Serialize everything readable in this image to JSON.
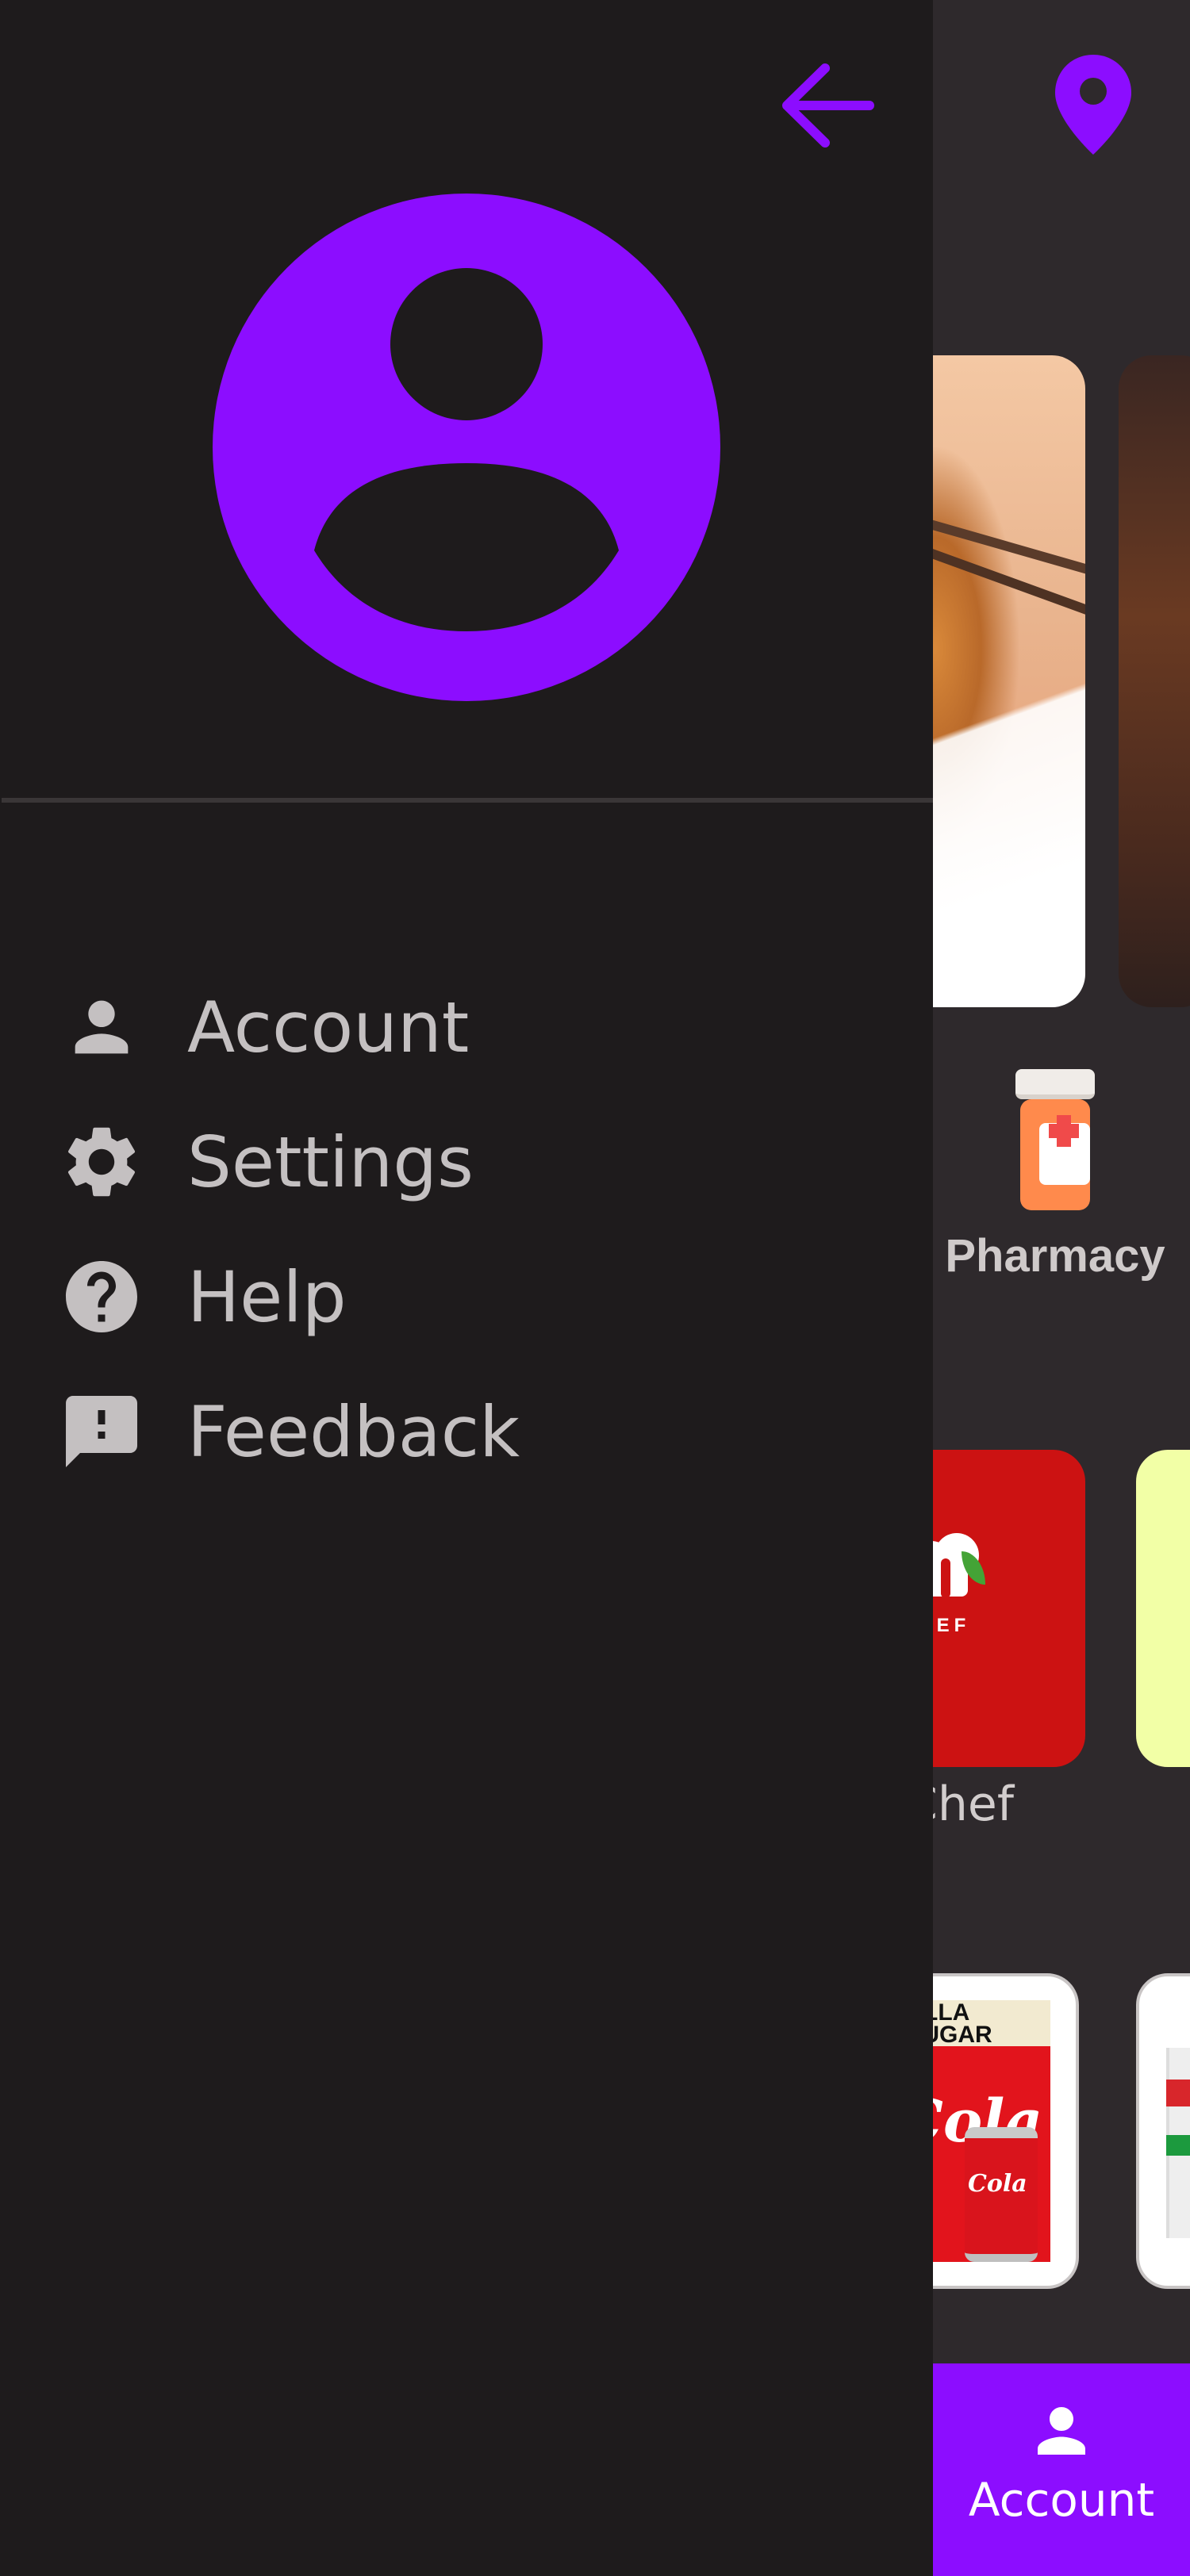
{
  "drawer": {
    "menu_items": [
      {
        "label": "Account",
        "icon": "person-icon"
      },
      {
        "label": "Settings",
        "icon": "gear-icon"
      },
      {
        "label": "Help",
        "icon": "help-circle-icon"
      },
      {
        "label": "Feedback",
        "icon": "feedback-icon"
      }
    ]
  },
  "background": {
    "category_label": "Pharmacy",
    "restaurant_label": "Chef",
    "restaurant_logo_text": "CHEF",
    "product_box_text": "NILLA\n SUGAR",
    "product_brand_text": "Cola",
    "product_can_text": "Cola",
    "bottom_nav_label": "Account"
  },
  "colors": {
    "accent": "#8c0dff",
    "drawer_bg": "#1e1b1c",
    "app_bg": "#2e292c",
    "menu_text": "#c4c0c1"
  }
}
